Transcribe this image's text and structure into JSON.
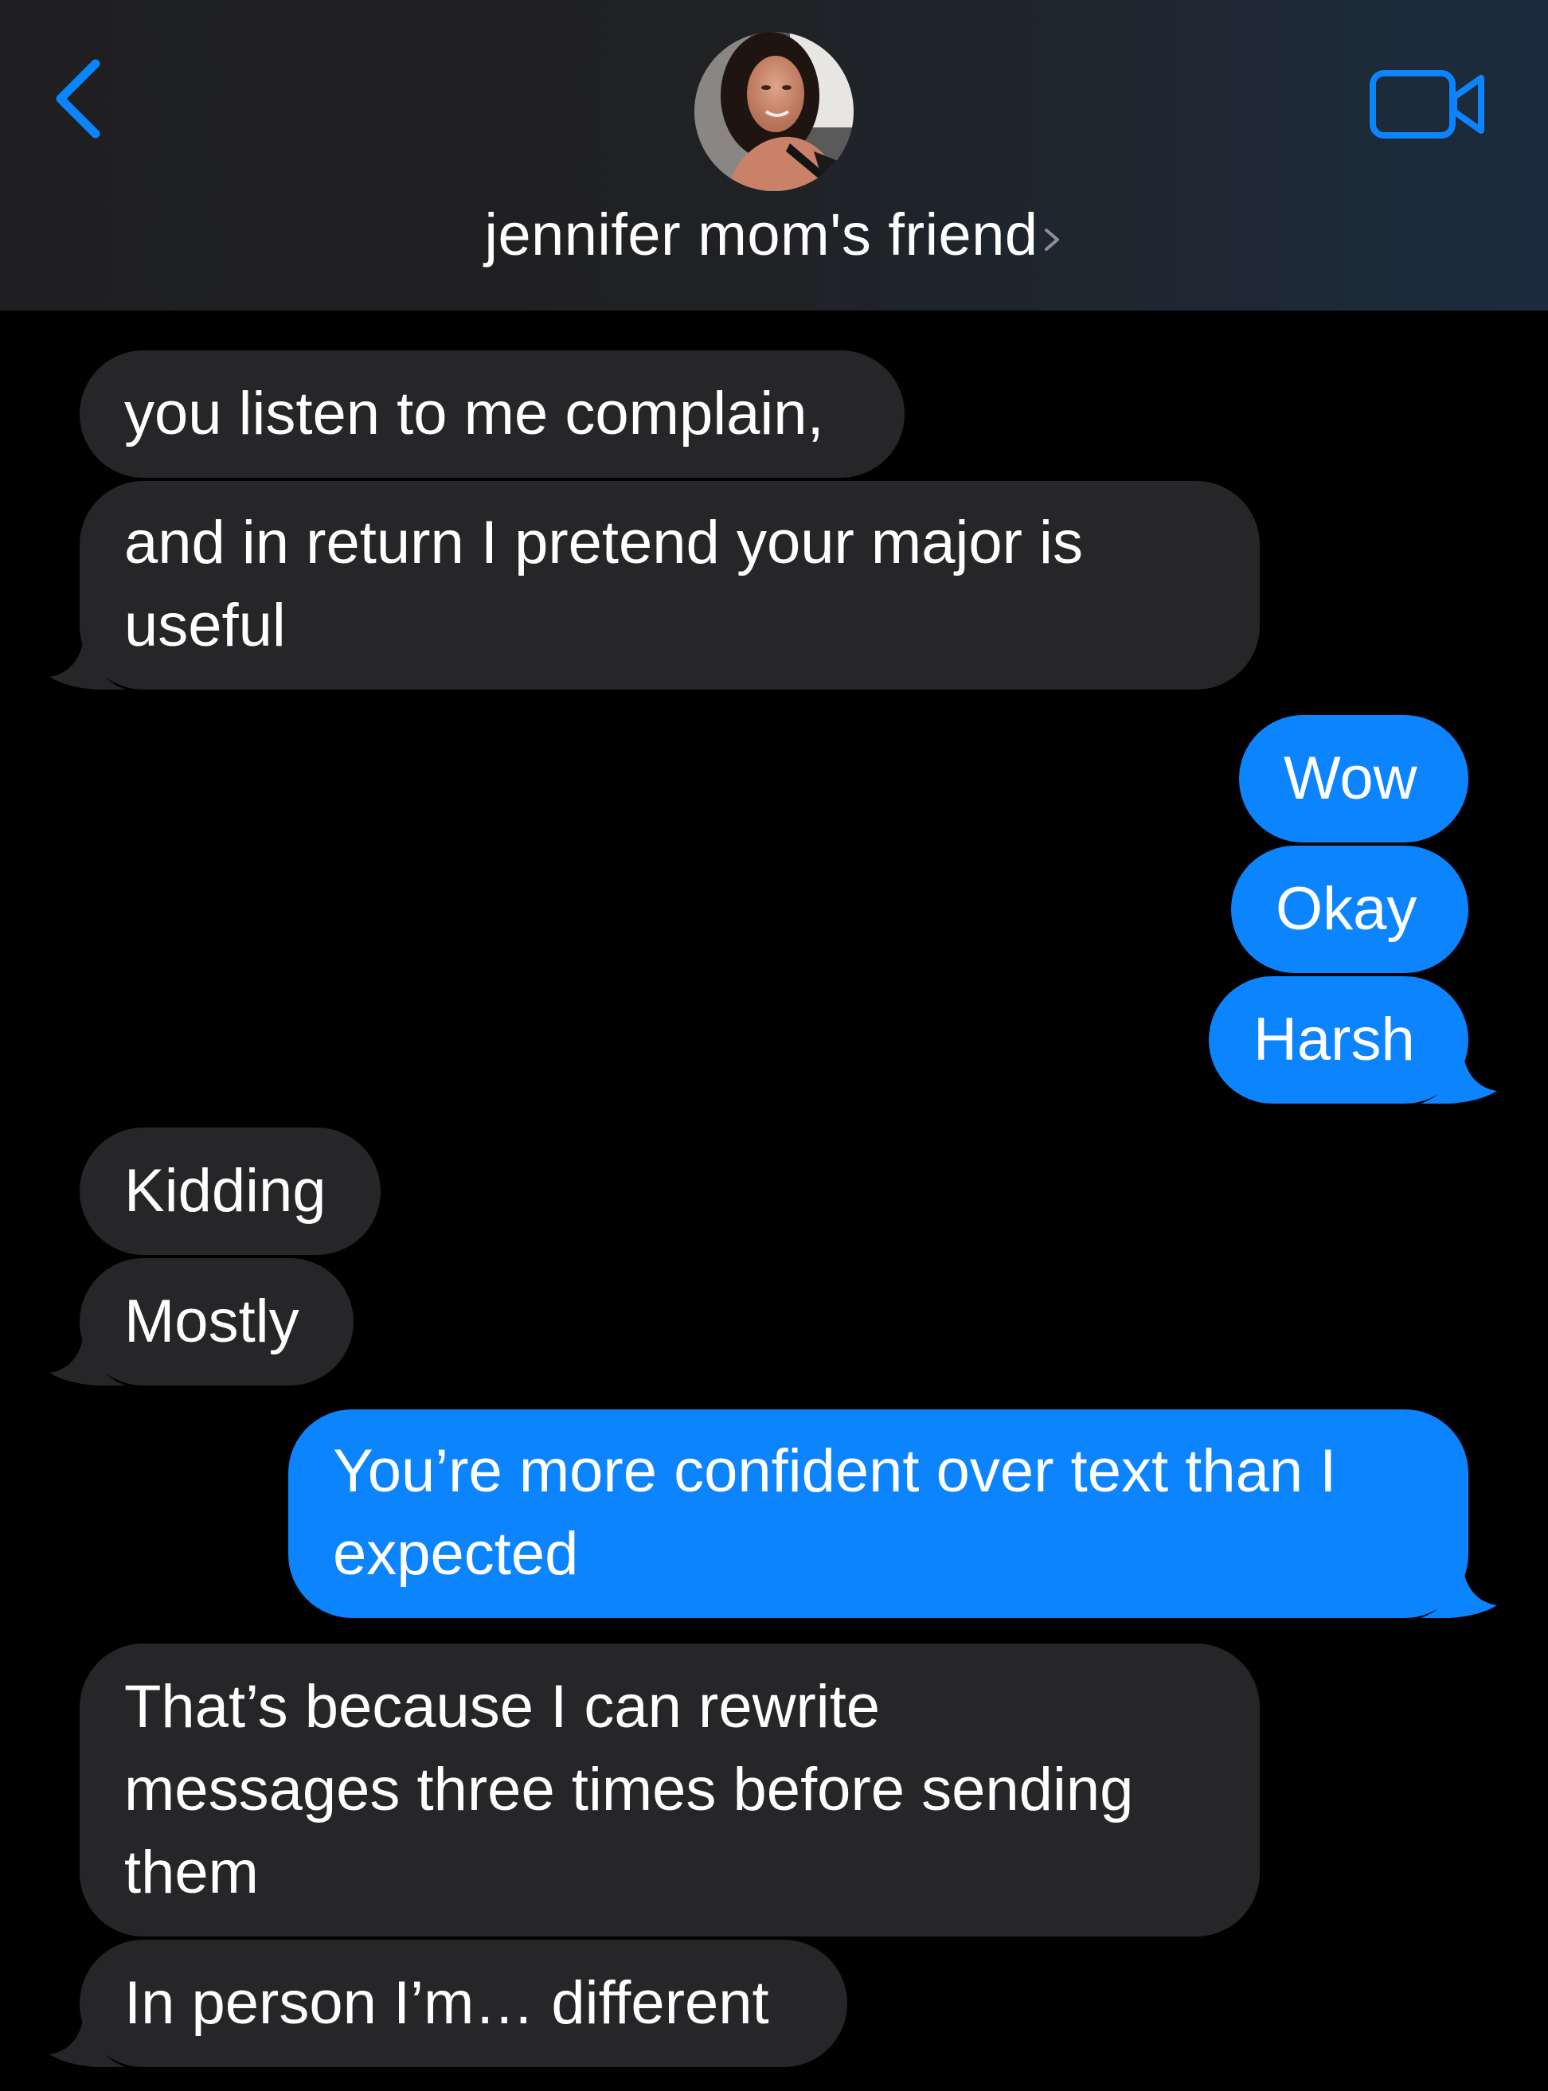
{
  "header": {
    "contact_name": "jennifer mom's friend",
    "back_icon": "chevron-left-icon",
    "video_icon": "video-camera-icon",
    "disclosure_icon": "chevron-right-icon",
    "accent_color": "#0b84fe"
  },
  "messages": [
    {
      "id": "m1",
      "direction": "incoming",
      "text": "you listen to me complain,"
    },
    {
      "id": "m2",
      "direction": "incoming",
      "lines": [
        "and in return I pretend your major is",
        "useful"
      ]
    },
    {
      "id": "m3",
      "direction": "outgoing",
      "text": "Wow"
    },
    {
      "id": "m4",
      "direction": "outgoing",
      "text": "Okay"
    },
    {
      "id": "m5",
      "direction": "outgoing",
      "text": "Harsh"
    },
    {
      "id": "m6",
      "direction": "incoming",
      "text": "Kidding"
    },
    {
      "id": "m7",
      "direction": "incoming",
      "text": "Mostly"
    },
    {
      "id": "m8",
      "direction": "outgoing",
      "lines": [
        "You’re more confident over text than I",
        "expected"
      ]
    },
    {
      "id": "m9",
      "direction": "incoming",
      "lines": [
        "That’s because I can rewrite",
        "messages three times before sending",
        "them"
      ]
    },
    {
      "id": "m10",
      "direction": "incoming",
      "text": "In person I’m… different"
    }
  ],
  "colors": {
    "incoming_bubble": "#262629",
    "outgoing_bubble": "#0b84fe",
    "background": "#000000"
  }
}
